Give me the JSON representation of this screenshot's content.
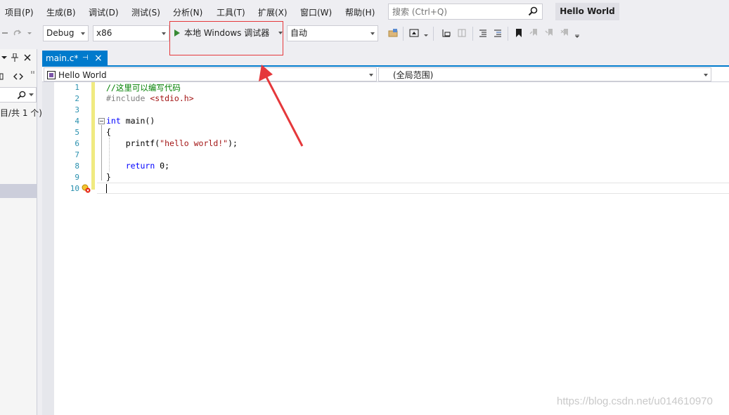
{
  "menu": {
    "items": [
      "项目(P)",
      "生成(B)",
      "调试(D)",
      "测试(S)",
      "分析(N)",
      "工具(T)",
      "扩展(X)",
      "窗口(W)",
      "帮助(H)"
    ],
    "search_placeholder": "搜索 (Ctrl+Q)",
    "solution_name": "Hello World"
  },
  "toolbar": {
    "config": "Debug",
    "platform": "x86",
    "run_label": "本地 Windows 调试器",
    "run_mode": "自动"
  },
  "left_panel": {
    "count_text": "目/共 1 个)"
  },
  "editor": {
    "tab_label": "main.c*",
    "nav_scope": "Hello World",
    "nav_member": "(全局范围)",
    "lines": [
      {
        "num": "1",
        "text": "//这里可以编写代码"
      },
      {
        "num": "2",
        "text": "#include <stdio.h>"
      },
      {
        "num": "3",
        "text": ""
      },
      {
        "num": "4",
        "text": "int main()"
      },
      {
        "num": "5",
        "text": "{"
      },
      {
        "num": "6",
        "text": "    printf(\"hello world!\");"
      },
      {
        "num": "7",
        "text": ""
      },
      {
        "num": "8",
        "text": "    return 0;"
      },
      {
        "num": "9",
        "text": "}"
      },
      {
        "num": "10",
        "text": ""
      }
    ]
  },
  "watermark": "https://blog.csdn.net/u014610970",
  "colors": {
    "accent": "#007acc",
    "highlight": "#e5383b",
    "play": "#388a34",
    "comment": "#008000",
    "keyword": "#0000ff",
    "preprocessor": "#808080",
    "string": "#a31515",
    "line_number": "#2b91af"
  }
}
